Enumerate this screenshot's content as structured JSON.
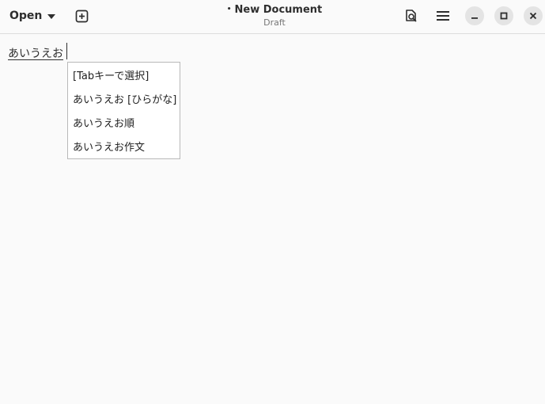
{
  "header": {
    "open_label": "Open",
    "title": "New Document",
    "modified_marker": "•",
    "subtitle": "Draft"
  },
  "editor": {
    "preedit_text": "あいうえお"
  },
  "candidates": {
    "items": [
      "[Tabキーで選択]",
      "あいうえお [ひらがな]",
      "あいうえお順",
      "あいうえお作文"
    ]
  }
}
